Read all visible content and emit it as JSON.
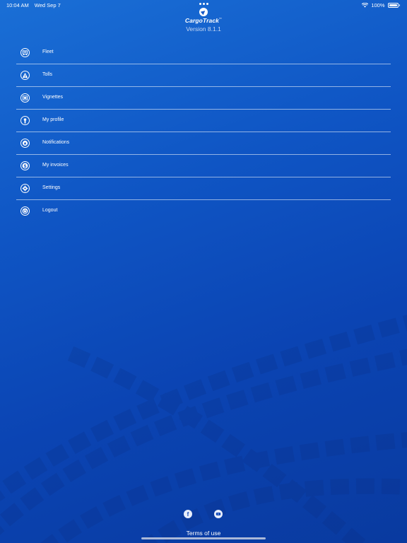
{
  "status_bar": {
    "time": "10:04 AM",
    "date": "Wed Sep 7",
    "battery": "100%",
    "icons": [
      "wifi-icon",
      "battery-icon"
    ]
  },
  "brand": {
    "logo_text": "CargoTrack",
    "trademark": "™",
    "version": "Version 8.1.1"
  },
  "menu": {
    "items": [
      {
        "label": "Fleet",
        "icon": "fleet-icon"
      },
      {
        "label": "Tolls",
        "icon": "tolls-icon"
      },
      {
        "label": "Vignettes",
        "icon": "vignettes-icon"
      },
      {
        "label": "My profile",
        "icon": "profile-icon"
      },
      {
        "label": "Notifications",
        "icon": "notifications-icon"
      },
      {
        "label": "My invoices",
        "icon": "invoices-icon"
      },
      {
        "label": "Settings",
        "icon": "settings-icon"
      },
      {
        "label": "Logout",
        "icon": "logout-icon"
      }
    ]
  },
  "footer": {
    "facebook_glyph": "f",
    "terms_label": "Terms of use",
    "icons": [
      "facebook-icon",
      "youtube-icon"
    ]
  },
  "colors": {
    "background_top": "#1a6fd6",
    "background_bottom": "#093a9f",
    "text": "#ffffff"
  }
}
